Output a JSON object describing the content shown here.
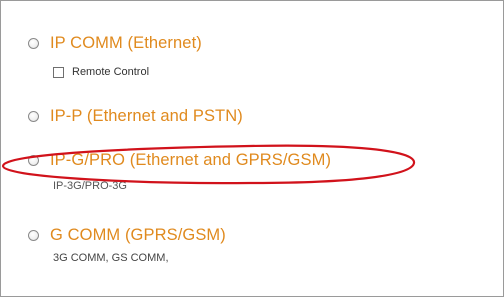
{
  "options": [
    {
      "label": "IP COMM (Ethernet)"
    },
    {
      "label": "IP-P (Ethernet and PSTN)"
    },
    {
      "label": "IP-G/PRO (Ethernet and GPRS/GSM)",
      "sub_text": "IP-3G/PRO-3G"
    },
    {
      "label": "G COMM (GPRS/GSM)",
      "sub_text": "3G COMM, GS COMM,"
    }
  ],
  "remote_control": {
    "label": "Remote Control",
    "checked": false
  },
  "annotation": {
    "shape": "ellipse",
    "color": "#d1121b",
    "target": "IP-G/PRO (Ethernet and GPRS/GSM)"
  },
  "colors": {
    "option_text": "#e08a1e",
    "annotation": "#d1121b"
  }
}
